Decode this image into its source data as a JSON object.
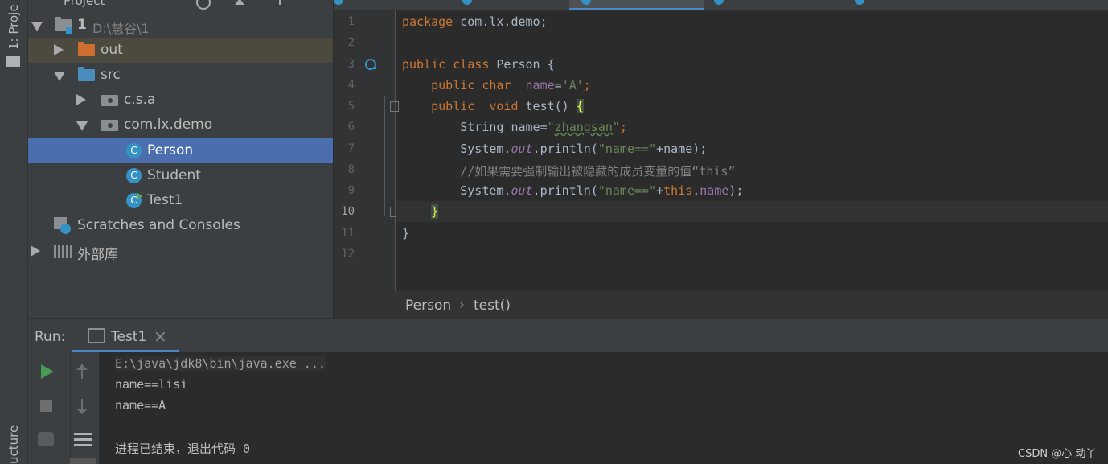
{
  "tool_strip": {
    "project_label": "1: Proje",
    "structure_label": "ucture"
  },
  "project_header_label": "Project",
  "tree": {
    "root_name": "1",
    "root_path": "D:\\慧谷\\1",
    "out": "out",
    "src": "src",
    "pkg1": "c.s.a",
    "pkg2": "com.lx.demo",
    "class_person": "Person",
    "class_student": "Student",
    "class_test1": "Test1",
    "scratches": "Scratches and Consoles",
    "external_libs": "外部库"
  },
  "editor": {
    "line_numbers": [
      "1",
      "2",
      "3",
      "4",
      "5",
      "6",
      "7",
      "8",
      "9",
      "10",
      "11",
      "12"
    ],
    "current_line": "10",
    "code": {
      "l1_kw": "package",
      "l1_rest": " com.lx.demo;",
      "l3_kw": "public class",
      "l3_rest": " Person {",
      "l4_kw": "    public char",
      "l4_sp": "  ",
      "l4_field": "name",
      "l4_eq": "=",
      "l4_str": "'A'",
      "l4_end": ";",
      "l5_kw": "    public",
      "l5_kw2": "  void",
      "l5_rest": " test() ",
      "l5_brace": "{",
      "l6_a": "        String name=",
      "l6_q1": "\"",
      "l6_str": "zhangsan",
      "l6_q2": "\"",
      "l6_end": ";",
      "l7_a": "        System.",
      "l7_out": "out",
      "l7_b": ".println(",
      "l7_str": "\"name==\"",
      "l7_c": "+name);",
      "l8_cmt": "        //如果需要强制输出被隐藏的成员变量的值“this”",
      "l9_a": "        System.",
      "l9_out": "out",
      "l9_b": ".println(",
      "l9_str": "\"name==\"",
      "l9_c": "+",
      "l9_this": "this",
      "l9_d": ".",
      "l9_field": "name",
      "l9_e": ");",
      "l10_brace": "}",
      "l10_indent": "    ",
      "l11": "}"
    },
    "breadcrumb_class": "Person",
    "breadcrumb_sep": "›",
    "breadcrumb_method": "test()"
  },
  "run": {
    "label": "Run:",
    "tab_name": "Test1",
    "close_glyph": "×",
    "console_lines": [
      "E:\\java\\jdk8\\bin\\java.exe ...",
      "name==lisi",
      "name==A",
      "进程已结束，退出代码 0"
    ]
  },
  "watermark": "CSDN @心 动丫",
  "colors": {
    "selection": "#4b6eaf",
    "keyword": "#cc7832",
    "string": "#6a8759",
    "field": "#9876aa",
    "run_green": "#499c54"
  }
}
